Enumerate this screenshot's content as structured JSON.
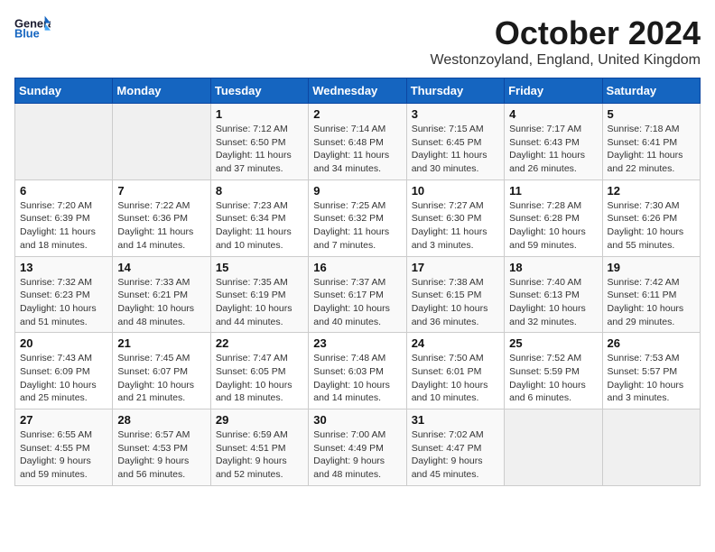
{
  "logo": {
    "general": "General",
    "blue": "Blue"
  },
  "title": "October 2024",
  "location": "Westonzoyland, England, United Kingdom",
  "weekdays": [
    "Sunday",
    "Monday",
    "Tuesday",
    "Wednesday",
    "Thursday",
    "Friday",
    "Saturday"
  ],
  "weeks": [
    [
      {
        "day": "",
        "info": ""
      },
      {
        "day": "",
        "info": ""
      },
      {
        "day": "1",
        "info": "Sunrise: 7:12 AM\nSunset: 6:50 PM\nDaylight: 11 hours and 37 minutes."
      },
      {
        "day": "2",
        "info": "Sunrise: 7:14 AM\nSunset: 6:48 PM\nDaylight: 11 hours and 34 minutes."
      },
      {
        "day": "3",
        "info": "Sunrise: 7:15 AM\nSunset: 6:45 PM\nDaylight: 11 hours and 30 minutes."
      },
      {
        "day": "4",
        "info": "Sunrise: 7:17 AM\nSunset: 6:43 PM\nDaylight: 11 hours and 26 minutes."
      },
      {
        "day": "5",
        "info": "Sunrise: 7:18 AM\nSunset: 6:41 PM\nDaylight: 11 hours and 22 minutes."
      }
    ],
    [
      {
        "day": "6",
        "info": "Sunrise: 7:20 AM\nSunset: 6:39 PM\nDaylight: 11 hours and 18 minutes."
      },
      {
        "day": "7",
        "info": "Sunrise: 7:22 AM\nSunset: 6:36 PM\nDaylight: 11 hours and 14 minutes."
      },
      {
        "day": "8",
        "info": "Sunrise: 7:23 AM\nSunset: 6:34 PM\nDaylight: 11 hours and 10 minutes."
      },
      {
        "day": "9",
        "info": "Sunrise: 7:25 AM\nSunset: 6:32 PM\nDaylight: 11 hours and 7 minutes."
      },
      {
        "day": "10",
        "info": "Sunrise: 7:27 AM\nSunset: 6:30 PM\nDaylight: 11 hours and 3 minutes."
      },
      {
        "day": "11",
        "info": "Sunrise: 7:28 AM\nSunset: 6:28 PM\nDaylight: 10 hours and 59 minutes."
      },
      {
        "day": "12",
        "info": "Sunrise: 7:30 AM\nSunset: 6:26 PM\nDaylight: 10 hours and 55 minutes."
      }
    ],
    [
      {
        "day": "13",
        "info": "Sunrise: 7:32 AM\nSunset: 6:23 PM\nDaylight: 10 hours and 51 minutes."
      },
      {
        "day": "14",
        "info": "Sunrise: 7:33 AM\nSunset: 6:21 PM\nDaylight: 10 hours and 48 minutes."
      },
      {
        "day": "15",
        "info": "Sunrise: 7:35 AM\nSunset: 6:19 PM\nDaylight: 10 hours and 44 minutes."
      },
      {
        "day": "16",
        "info": "Sunrise: 7:37 AM\nSunset: 6:17 PM\nDaylight: 10 hours and 40 minutes."
      },
      {
        "day": "17",
        "info": "Sunrise: 7:38 AM\nSunset: 6:15 PM\nDaylight: 10 hours and 36 minutes."
      },
      {
        "day": "18",
        "info": "Sunrise: 7:40 AM\nSunset: 6:13 PM\nDaylight: 10 hours and 32 minutes."
      },
      {
        "day": "19",
        "info": "Sunrise: 7:42 AM\nSunset: 6:11 PM\nDaylight: 10 hours and 29 minutes."
      }
    ],
    [
      {
        "day": "20",
        "info": "Sunrise: 7:43 AM\nSunset: 6:09 PM\nDaylight: 10 hours and 25 minutes."
      },
      {
        "day": "21",
        "info": "Sunrise: 7:45 AM\nSunset: 6:07 PM\nDaylight: 10 hours and 21 minutes."
      },
      {
        "day": "22",
        "info": "Sunrise: 7:47 AM\nSunset: 6:05 PM\nDaylight: 10 hours and 18 minutes."
      },
      {
        "day": "23",
        "info": "Sunrise: 7:48 AM\nSunset: 6:03 PM\nDaylight: 10 hours and 14 minutes."
      },
      {
        "day": "24",
        "info": "Sunrise: 7:50 AM\nSunset: 6:01 PM\nDaylight: 10 hours and 10 minutes."
      },
      {
        "day": "25",
        "info": "Sunrise: 7:52 AM\nSunset: 5:59 PM\nDaylight: 10 hours and 6 minutes."
      },
      {
        "day": "26",
        "info": "Sunrise: 7:53 AM\nSunset: 5:57 PM\nDaylight: 10 hours and 3 minutes."
      }
    ],
    [
      {
        "day": "27",
        "info": "Sunrise: 6:55 AM\nSunset: 4:55 PM\nDaylight: 9 hours and 59 minutes."
      },
      {
        "day": "28",
        "info": "Sunrise: 6:57 AM\nSunset: 4:53 PM\nDaylight: 9 hours and 56 minutes."
      },
      {
        "day": "29",
        "info": "Sunrise: 6:59 AM\nSunset: 4:51 PM\nDaylight: 9 hours and 52 minutes."
      },
      {
        "day": "30",
        "info": "Sunrise: 7:00 AM\nSunset: 4:49 PM\nDaylight: 9 hours and 48 minutes."
      },
      {
        "day": "31",
        "info": "Sunrise: 7:02 AM\nSunset: 4:47 PM\nDaylight: 9 hours and 45 minutes."
      },
      {
        "day": "",
        "info": ""
      },
      {
        "day": "",
        "info": ""
      }
    ]
  ]
}
